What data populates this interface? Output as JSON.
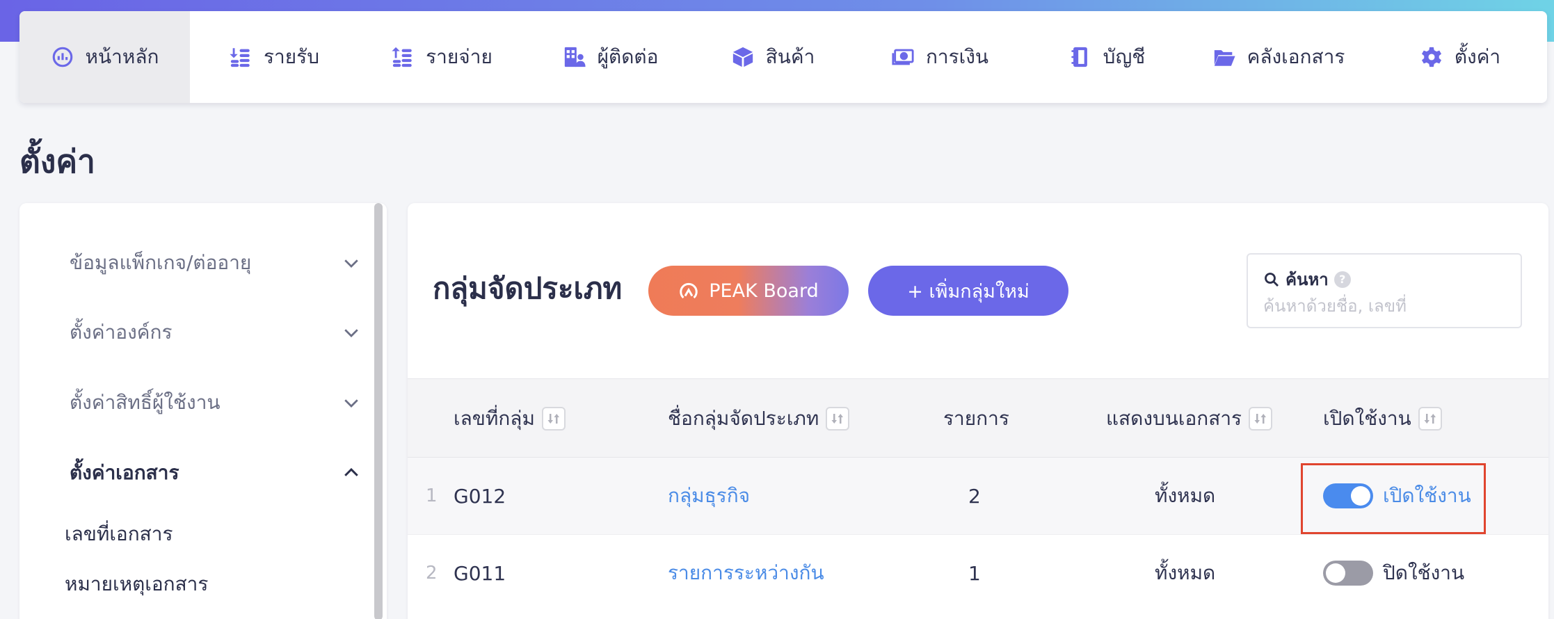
{
  "nav": {
    "items": [
      {
        "label": "หน้าหลัก",
        "icon": "dashboard-icon"
      },
      {
        "label": "รายรับ",
        "icon": "income-icon"
      },
      {
        "label": "รายจ่าย",
        "icon": "expense-icon"
      },
      {
        "label": "ผู้ติดต่อ",
        "icon": "contacts-icon"
      },
      {
        "label": "สินค้า",
        "icon": "box-icon"
      },
      {
        "label": "การเงิน",
        "icon": "money-icon"
      },
      {
        "label": "บัญชี",
        "icon": "ledger-icon"
      },
      {
        "label": "คลังเอกสาร",
        "icon": "folder-icon"
      },
      {
        "label": "ตั้งค่า",
        "icon": "gear-icon"
      }
    ],
    "active_index": 0
  },
  "page": {
    "title": "ตั้งค่า"
  },
  "sidebar": {
    "groups": [
      {
        "label": "ข้อมูลแพ็กเกจ/ต่ออายุ",
        "state": "collapsed"
      },
      {
        "label": "ตั้งค่าองค์กร",
        "state": "collapsed"
      },
      {
        "label": "ตั้งค่าสิทธิ์ผู้ใช้งาน",
        "state": "collapsed"
      },
      {
        "label": "ตั้งค่าเอกสาร",
        "state": "expanded"
      }
    ],
    "sub_items": [
      {
        "label": "เลขที่เอกสาร"
      },
      {
        "label": "หมายเหตุเอกสาร"
      }
    ]
  },
  "main": {
    "title": "กลุ่มจัดประเภท",
    "peak_button": "PEAK Board",
    "add_button": "+ เพิ่มกลุ่มใหม่",
    "search": {
      "label": "ค้นหา",
      "help": "?",
      "placeholder": "ค้นหาด้วยชื่อ, เลขที่"
    },
    "table": {
      "headers": [
        "เลขที่กลุ่ม",
        "ชื่อกลุ่มจัดประเภท",
        "รายการ",
        "แสดงบนเอกสาร",
        "เปิดใช้งาน"
      ],
      "rows": [
        {
          "index": "1",
          "code": "G012",
          "name": "กลุ่มธุรกิจ",
          "count": "2",
          "display": "ทั้งหมด",
          "enabled": true,
          "status": "เปิดใช้งาน"
        },
        {
          "index": "2",
          "code": "G011",
          "name": "รายการระหว่างกัน",
          "count": "1",
          "display": "ทั้งหมด",
          "enabled": false,
          "status": "ปิดใช้งาน"
        }
      ]
    }
  },
  "colors": {
    "accent": "#6b68e8",
    "link": "#4a8be6",
    "toggle_on": "#4a8bee",
    "toggle_off": "#9b9ba6",
    "highlight": "#e0452f"
  }
}
